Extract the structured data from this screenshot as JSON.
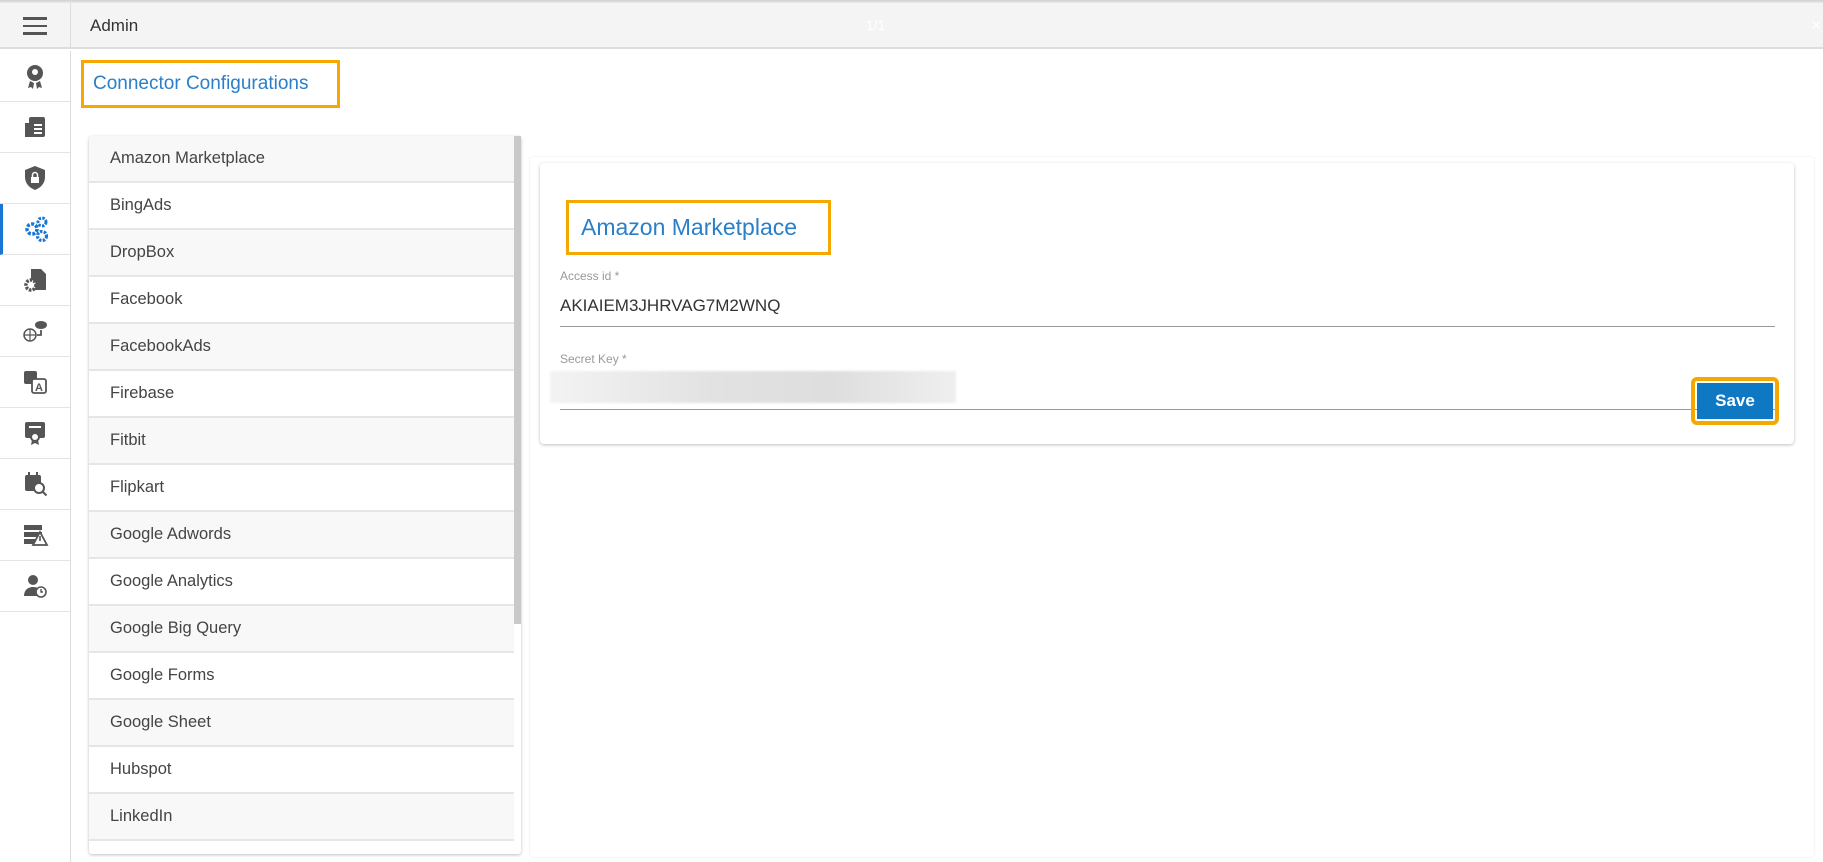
{
  "header": {
    "title": "Admin",
    "pager": "1/1",
    "close": "×"
  },
  "sidebar": {
    "items": [
      {
        "name": "sidebar-item-user-badge",
        "icon": "user-gear-badge-icon"
      },
      {
        "name": "sidebar-item-billing",
        "icon": "invoice-icon"
      },
      {
        "name": "sidebar-item-security",
        "icon": "shield-lock-icon"
      },
      {
        "name": "sidebar-item-connector-configurations",
        "icon": "gears-icon",
        "active": true
      },
      {
        "name": "sidebar-item-file-settings",
        "icon": "file-gear-icon"
      },
      {
        "name": "sidebar-item-network",
        "icon": "globe-cloud-icon"
      },
      {
        "name": "sidebar-item-language",
        "icon": "translate-icon"
      },
      {
        "name": "sidebar-item-certificate",
        "icon": "certificate-icon"
      },
      {
        "name": "sidebar-item-scheduler",
        "icon": "calendar-search-icon"
      },
      {
        "name": "sidebar-item-server-alerts",
        "icon": "server-warning-icon"
      },
      {
        "name": "sidebar-item-user-history",
        "icon": "user-clock-icon"
      }
    ]
  },
  "page_title": "Connector Configurations",
  "connectors": [
    "Amazon Marketplace",
    "BingAds",
    "DropBox",
    "Facebook",
    "FacebookAds",
    "Firebase",
    "Fitbit",
    "Flipkart",
    "Google Adwords",
    "Google Analytics",
    "Google Big Query",
    "Google Forms",
    "Google Sheet",
    "Hubspot",
    "LinkedIn"
  ],
  "form": {
    "title": "Amazon Marketplace",
    "access_id_label": "Access id *",
    "access_id_value": "AKIAIEM3JHRVAG7M2WNQ",
    "secret_key_label": "Secret Key *",
    "save_label": "Save"
  },
  "colors": {
    "accent": "#2a7fc8",
    "highlight": "#f5a800",
    "button": "#0f78c2"
  }
}
